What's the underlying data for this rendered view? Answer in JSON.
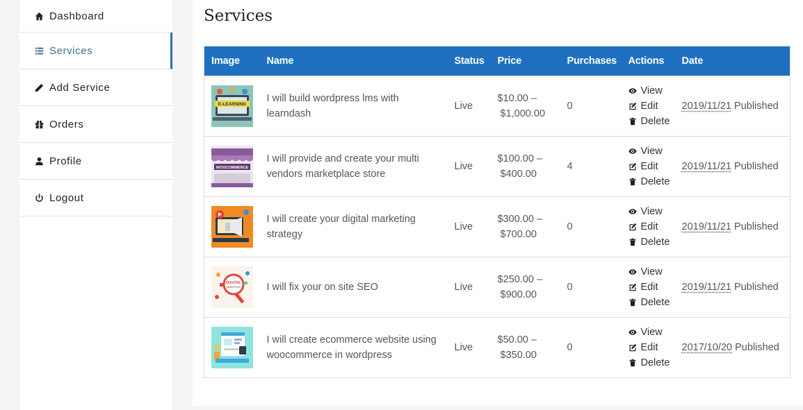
{
  "sidebar": {
    "items": [
      {
        "label": "Dashboard",
        "icon": "home-icon"
      },
      {
        "label": "Services",
        "icon": "list-icon"
      },
      {
        "label": "Add Service",
        "icon": "pencil-icon"
      },
      {
        "label": "Orders",
        "icon": "gift-icon"
      },
      {
        "label": "Profile",
        "icon": "user-icon"
      },
      {
        "label": "Logout",
        "icon": "power-icon"
      }
    ]
  },
  "page": {
    "title": "Services"
  },
  "table": {
    "headers": [
      "Image",
      "Name",
      "Status",
      "Price",
      "Purchases",
      "Actions",
      "Date"
    ],
    "actions": [
      "View",
      "Edit",
      "Delete"
    ],
    "rows": [
      {
        "name": "I will build wordpress lms with learndash",
        "status": "Live",
        "price_min": "$10.00 –",
        "price_max": "$1,000.00",
        "purchases": "0",
        "date": "2019/11/21",
        "state": "Published"
      },
      {
        "name": "I will provide and create your multi vendors marketplace store",
        "status": "Live",
        "price_min": "$100.00 –",
        "price_max": "$400.00",
        "purchases": "4",
        "date": "2019/11/21",
        "state": "Published"
      },
      {
        "name": "I will create your digital marketing strategy",
        "status": "Live",
        "price_min": "$300.00 –",
        "price_max": "$700.00",
        "purchases": "0",
        "date": "2019/11/21",
        "state": "Published"
      },
      {
        "name": "I will fix your on site SEO",
        "status": "Live",
        "price_min": "$250.00 –",
        "price_max": "$900.00",
        "purchases": "0",
        "date": "2019/11/21",
        "state": "Published"
      },
      {
        "name": "I will create ecommerce website using woocommerce in wordpress",
        "status": "Live",
        "price_min": "$50.00 –",
        "price_max": "$350.00",
        "purchases": "0",
        "date": "2017/10/20",
        "state": "Published"
      }
    ]
  },
  "colors": {
    "header_bg": "#1f70c0",
    "active_accent": "#2a6fb7"
  }
}
